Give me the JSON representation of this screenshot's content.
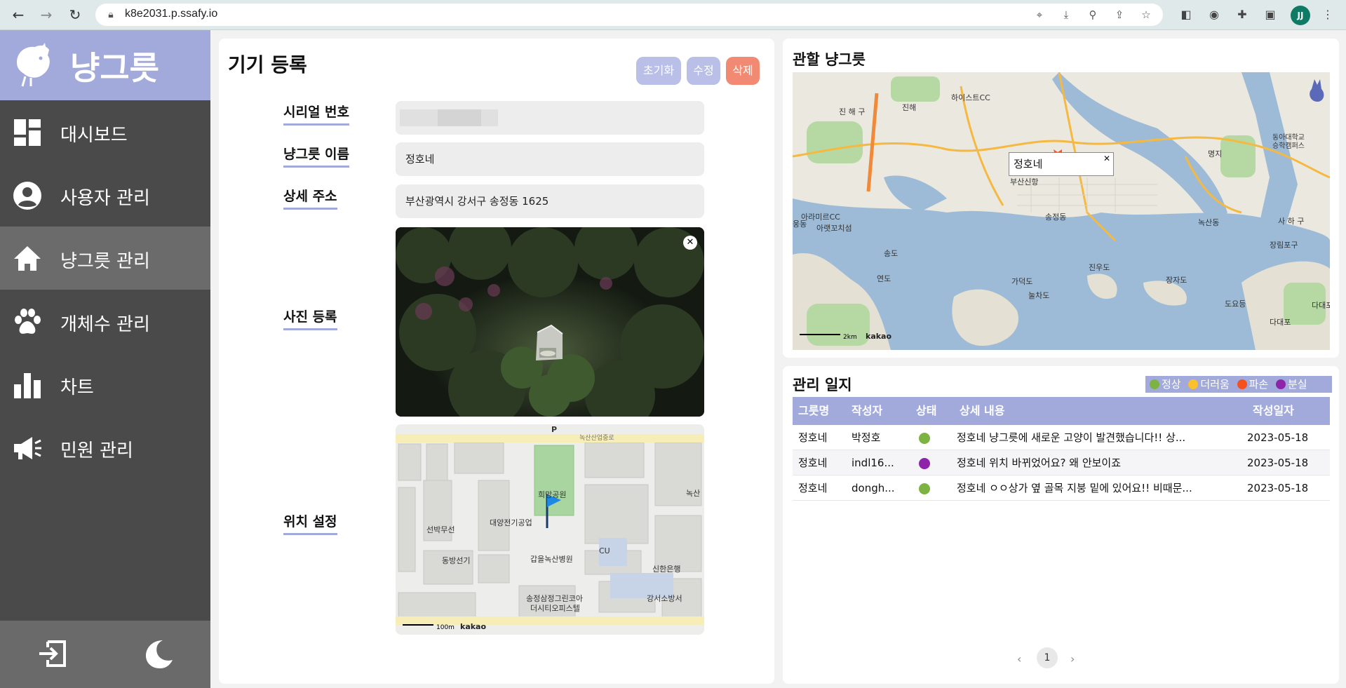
{
  "browser": {
    "url": "k8e2031.p.ssafy.io",
    "profile_initials": "JJ"
  },
  "sidebar": {
    "brand": "냥그릇",
    "items": [
      {
        "label": "대시보드",
        "icon": "dashboard-icon"
      },
      {
        "label": "사용자 관리",
        "icon": "user-circle-icon"
      },
      {
        "label": "냥그릇 관리",
        "icon": "home-icon",
        "active": true
      },
      {
        "label": "개체수 관리",
        "icon": "paw-icon"
      },
      {
        "label": "차트",
        "icon": "bar-chart-icon"
      },
      {
        "label": "민원 관리",
        "icon": "megaphone-icon"
      }
    ]
  },
  "device_form": {
    "title": "기기 등록",
    "buttons": {
      "reset": "초기화",
      "edit": "수정",
      "delete": "삭제"
    },
    "labels": {
      "serial": "시리얼 번호",
      "name": "냥그릇 이름",
      "address": "상세 주소",
      "photo": "사진 등록",
      "location": "위치 설정"
    },
    "values": {
      "name": "정호네",
      "address": "부산광역시 강서구 송정동 1625"
    },
    "location_map": {
      "labels": [
        "녹산산업중로",
        "희망공원",
        "대양전기공업",
        "선박무선",
        "동방선기",
        "갑을녹산병원",
        "CU",
        "신한은행",
        "송정삼정그린코아 더시티오피스텔",
        "강서소방서",
        "녹산",
        "P"
      ],
      "scale": "100m",
      "attribution": "kakao"
    }
  },
  "area_map": {
    "title": "관할 냥그릇",
    "popup": "정호네",
    "labels": [
      "하이스트CC",
      "진 해 구",
      "진해",
      "명지",
      "동아대학교 승학캠퍼스",
      "아라미르CC",
      "아랫꼬치섬",
      "송도",
      "연도",
      "가덕도",
      "눌차도",
      "진우도",
      "장자도",
      "도요등",
      "다대포",
      "장림포구",
      "사 하 구",
      "다대포",
      "부산신항",
      "송정동",
      "녹산동",
      "웅동"
    ],
    "scale": "2km",
    "attribution": "kakao"
  },
  "log": {
    "title": "관리 일지",
    "legend": [
      {
        "label": "정상",
        "color": "#7cb342"
      },
      {
        "label": "더러움",
        "color": "#fbc02d"
      },
      {
        "label": "파손",
        "color": "#f4511e"
      },
      {
        "label": "분실",
        "color": "#8e24aa"
      }
    ],
    "headers": [
      "그릇명",
      "작성자",
      "상태",
      "상세 내용",
      "작성일자"
    ],
    "rows": [
      {
        "bowl": "정호네",
        "author": "박정호",
        "status_color": "#7cb342",
        "content": "정호네 냥그릇에 새로운 고양이 발견했습니다!! 상...",
        "date": "2023-05-18"
      },
      {
        "bowl": "정호네",
        "author": "indl16...",
        "status_color": "#8e24aa",
        "content": "정호네 위치 바뀌었어요? 왜 안보이죠",
        "date": "2023-05-18"
      },
      {
        "bowl": "정호네",
        "author": "dongh...",
        "status_color": "#7cb342",
        "content": "정호네 ㅇㅇ상가 옆 골목 지붕 밑에 있어요!! 비때문...",
        "date": "2023-05-18"
      }
    ],
    "pagination": {
      "current": "1",
      "prev": "‹",
      "next": "›"
    }
  }
}
